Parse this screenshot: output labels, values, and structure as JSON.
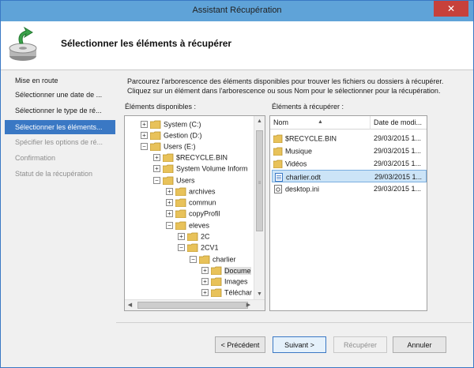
{
  "window": {
    "title": "Assistant Récupération",
    "close_glyph": "✕"
  },
  "header": {
    "title": "Sélectionner les éléments à récupérer"
  },
  "nav": {
    "items": [
      {
        "label": "Mise en route",
        "state": "normal"
      },
      {
        "label": "Sélectionner une date de ...",
        "state": "normal"
      },
      {
        "label": "Sélectionner le type de ré...",
        "state": "normal"
      },
      {
        "label": "Sélectionner les éléments...",
        "state": "active"
      },
      {
        "label": "Spécifier les options de ré...",
        "state": "disabled"
      },
      {
        "label": "Confirmation",
        "state": "disabled"
      },
      {
        "label": "Statut de la récupération",
        "state": "disabled"
      }
    ]
  },
  "description": {
    "line1": "Parcourez l'arborescence des éléments disponibles pour trouver les fichiers ou dossiers à récupérer.",
    "line2": "Cliquez sur un élément dans l'arborescence ou sous Nom pour le sélectionner pour la récupération."
  },
  "tree": {
    "label": "Éléments disponibles :",
    "nodes": [
      {
        "label": "System (C:)",
        "toggle": "+"
      },
      {
        "label": "Gestion (D:)",
        "toggle": "+"
      },
      {
        "label": "Users (E:)",
        "toggle": "−"
      },
      {
        "label": "$RECYCLE.BIN",
        "toggle": "+"
      },
      {
        "label": "System Volume Inform",
        "toggle": "+"
      },
      {
        "label": "Users",
        "toggle": "−"
      },
      {
        "label": "archives",
        "toggle": "+"
      },
      {
        "label": "commun",
        "toggle": "+"
      },
      {
        "label": "copyProfil",
        "toggle": "+"
      },
      {
        "label": "eleves",
        "toggle": "−"
      },
      {
        "label": "2C",
        "toggle": "+"
      },
      {
        "label": "2CV1",
        "toggle": "−"
      },
      {
        "label": "charlier",
        "toggle": "−"
      },
      {
        "label": "Docume",
        "toggle": "+"
      },
      {
        "label": "Images",
        "toggle": "+"
      },
      {
        "label": "Téléchar",
        "toggle": "+"
      }
    ]
  },
  "list": {
    "label": "Éléments à récupérer :",
    "col_name": "Nom",
    "col_date": "Date de modi...",
    "sort_glyph": "▲",
    "rows": [
      {
        "name": "$RECYCLE.BIN",
        "date": "29/03/2015 1...",
        "kind": "folder"
      },
      {
        "name": "Musique",
        "date": "29/03/2015 1...",
        "kind": "folder"
      },
      {
        "name": "Vidéos",
        "date": "29/03/2015 1...",
        "kind": "folder"
      },
      {
        "name": "charlier.odt",
        "date": "29/03/2015 1...",
        "kind": "file"
      },
      {
        "name": "desktop.ini",
        "date": "29/03/2015 1...",
        "kind": "ini"
      }
    ]
  },
  "buttons": {
    "previous": "< Précédent",
    "next": "Suivant >",
    "recover": "Récupérer",
    "cancel": "Annuler"
  },
  "colors": {
    "accent": "#3a78c4",
    "folder": "#e8c25a",
    "selection": "#cce4f7"
  }
}
